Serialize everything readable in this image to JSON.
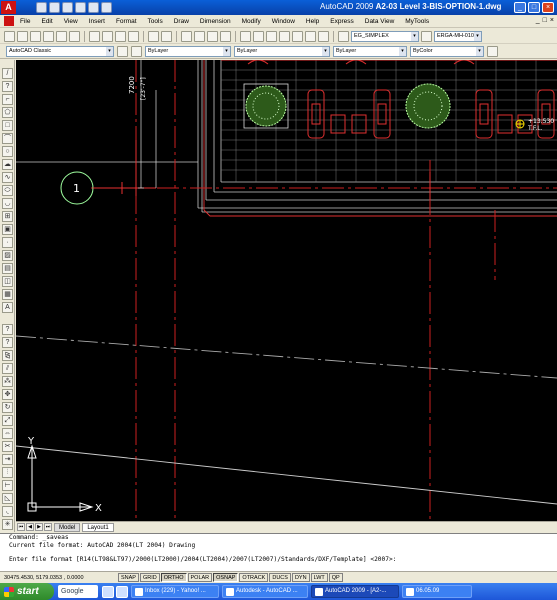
{
  "app": {
    "logo_letter": "A",
    "title_prefix": "AutoCAD 2009 ",
    "title_file": "A2-03 Level 3-BIS-OPTION-1.dwg"
  },
  "window_controls": {
    "minimize": "_",
    "maximize": "□",
    "close": "×"
  },
  "menu": [
    "File",
    "Edit",
    "View",
    "Insert",
    "Format",
    "Tools",
    "Draw",
    "Dimension",
    "Modify",
    "Window",
    "Help",
    "Express",
    "Data View",
    "MyTools"
  ],
  "toolbar": {
    "workspace": "AutoCAD Classic",
    "layer": "ByLayer",
    "linetype": "ByLayer",
    "lineweight": "ByLayer",
    "color": "ByColor",
    "textstyle": "EG_SIMPLEX",
    "dimstyle": "ERGA-MH-0100"
  },
  "drawing": {
    "dimension_text": "7200",
    "dimension_subtext": "[23'-7\"]",
    "grid_bubble": "1",
    "level_text": "+13.530",
    "level_subtext": "T.F.L."
  },
  "ucs": {
    "x_label": "X",
    "y_label": "Y"
  },
  "tabs": {
    "model": "Model",
    "layout1": "Layout1"
  },
  "command": {
    "line1": "Command: _saveas",
    "line2": "Current file format: AutoCAD 2004(LT 2004) Drawing",
    "line3": "Enter file format [R14(LT98&LT97)/2000(LT2000)/2004(LT2004)/2007(LT2007)/Standards/DXF/Template] <2007>:"
  },
  "status": {
    "coords": "30475.4530, 5179.0353 , 0.0000",
    "buttons": [
      {
        "label": "SNAP",
        "on": false
      },
      {
        "label": "GRID",
        "on": false
      },
      {
        "label": "ORTHO",
        "on": true
      },
      {
        "label": "POLAR",
        "on": false
      },
      {
        "label": "OSNAP",
        "on": true
      },
      {
        "label": "OTRACK",
        "on": false
      },
      {
        "label": "DUCS",
        "on": false
      },
      {
        "label": "DYN",
        "on": false
      },
      {
        "label": "LWT",
        "on": false
      },
      {
        "label": "QP",
        "on": false
      }
    ]
  },
  "taskbar": {
    "start": "start",
    "google": "Google",
    "tasks": [
      {
        "label": "Inbox (229) - Yahoo! ...",
        "active": false
      },
      {
        "label": "Autodesk - AutoCAD ...",
        "active": false
      },
      {
        "label": "AutoCAD 2009 - [A2-...",
        "active": true
      },
      {
        "label": "06.05.09",
        "active": false
      }
    ]
  }
}
